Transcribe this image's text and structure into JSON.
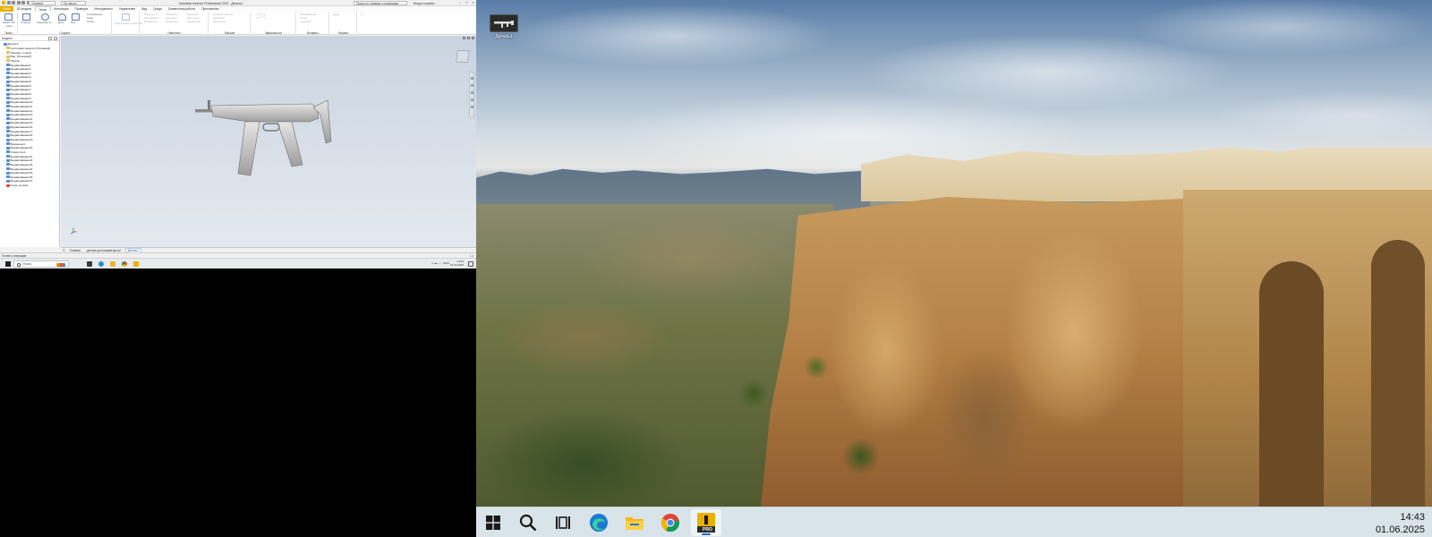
{
  "remote": {
    "titlebar": {
      "workspace_label": "Типовой",
      "mode_label": "По умолч",
      "app_title": "Autodesk Inventor Professional 2022 - Деталь1",
      "help_search_placeholder": "Поиск по справке и командам",
      "signin_label": "Вход в службы"
    },
    "ribbon_tabs": [
      "3D-модель",
      "Эскиз",
      "Аннотация",
      "Проверка",
      "Инструменты",
      "Управление",
      "Вид",
      "Среда",
      "Совместная работа",
      "Приложения"
    ],
    "ribbon_tab_active_index": 1,
    "file_tab": "Файл",
    "ribbon_groups": [
      {
        "name": "Эскиз",
        "items": [
          "Начать 2D-эскиз"
        ]
      },
      {
        "name": "Создать",
        "items": [
          "Отрезок",
          "Окружность",
          "Дуга",
          "Прямоугольник",
          "Сопряжение",
          "Текст",
          "Точка"
        ]
      },
      {
        "name": "Изменить",
        "items": [
          "Перенести",
          "Копировать",
          "Повернуть",
          "Обрезать",
          "Удлинить",
          "Разделить",
          "Масштаб",
          "Растянуть",
          "Смещение"
        ]
      },
      {
        "name": "Массив",
        "items": [
          "Прямоугольный",
          "Круговой",
          "Зеркально"
        ]
      },
      {
        "name": "Зависимости",
        "items": []
      },
      {
        "name": "Вставить",
        "items": [
          "Изображение",
          "Точки",
          "AutoCAD"
        ]
      },
      {
        "name": "Формат",
        "items": []
      }
    ],
    "browser": {
      "title": "Модель",
      "items": [
        {
          "label": "Деталь1",
          "kind": "part"
        },
        {
          "label": "Состояния модели: [Основной]",
          "kind": "folder"
        },
        {
          "label": "Твердые тела(1)",
          "kind": "folder"
        },
        {
          "label": "Вид: [Основной]",
          "kind": "folder"
        },
        {
          "label": "Начало",
          "kind": "folder"
        },
        {
          "label": "Выдавливание1",
          "kind": "ex"
        },
        {
          "label": "Выдавливание2",
          "kind": "ex"
        },
        {
          "label": "Выдавливание3",
          "kind": "ex"
        },
        {
          "label": "Выдавливание4",
          "kind": "ex"
        },
        {
          "label": "Выдавливание5",
          "kind": "ex"
        },
        {
          "label": "Выдавливание6",
          "kind": "ex"
        },
        {
          "label": "Выдавливание7",
          "kind": "ex"
        },
        {
          "label": "Выдавливание8",
          "kind": "ex"
        },
        {
          "label": "Выдавливание9",
          "kind": "ex"
        },
        {
          "label": "Выдавливание10",
          "kind": "ex"
        },
        {
          "label": "Выдавливание11",
          "kind": "ex"
        },
        {
          "label": "Выдавливание12",
          "kind": "ex"
        },
        {
          "label": "Выдавливание13",
          "kind": "ex"
        },
        {
          "label": "Выдавливание14",
          "kind": "ex"
        },
        {
          "label": "Выдавливание15",
          "kind": "ex"
        },
        {
          "label": "Выдавливание16",
          "kind": "ex"
        },
        {
          "label": "Выдавливание17",
          "kind": "ex"
        },
        {
          "label": "Выдавливание18",
          "kind": "ex"
        },
        {
          "label": "Выдавливание19",
          "kind": "ex"
        },
        {
          "label": "Вращение1",
          "kind": "ex"
        },
        {
          "label": "Выдавливание20",
          "kind": "ex"
        },
        {
          "label": "Отверстие1",
          "kind": "ex"
        },
        {
          "label": "Выдавливание21",
          "kind": "ex"
        },
        {
          "label": "Выдавливание22",
          "kind": "ex"
        },
        {
          "label": "Выдавливание23",
          "kind": "ex"
        },
        {
          "label": "Выдавливание24",
          "kind": "ex"
        },
        {
          "label": "Выдавливание25",
          "kind": "ex"
        },
        {
          "label": "Выдавливание26",
          "kind": "ex"
        },
        {
          "label": "Выдавливание27",
          "kind": "ex"
        },
        {
          "label": "Конец детали",
          "kind": "end"
        }
      ]
    },
    "doc_tabs": [
      {
        "label": "Главная",
        "active": false
      },
      {
        "label": "детали для параметра.ipt",
        "active": false
      },
      {
        "label": "Деталь1",
        "active": true
      }
    ],
    "status_text": "Готово к операции",
    "status_right": "1    1",
    "taskbar": {
      "search_placeholder": "Поиск",
      "tray_time": "14:43",
      "tray_date": "01.06.2025",
      "lang": "ENG"
    }
  },
  "desktop": {
    "icon_label": "Деталь1"
  },
  "taskbar": {
    "pinned": [
      {
        "name": "start",
        "icon": "windows-logo"
      },
      {
        "name": "search",
        "icon": "search-icon"
      },
      {
        "name": "task-view",
        "icon": "task-view-icon"
      },
      {
        "name": "edge",
        "icon": "edge-icon"
      },
      {
        "name": "explorer",
        "icon": "folder-icon"
      },
      {
        "name": "chrome",
        "icon": "chrome-icon"
      },
      {
        "name": "inventor",
        "icon": "inventor-icon",
        "active": true
      }
    ],
    "time": "14:43",
    "date": "01.06.2025",
    "inventor_badge": "PRO"
  },
  "colors": {
    "inventor_accent": "#e8b100",
    "taskbar_bg": "#d9e4ea",
    "viewport_bg": "#cad4e0"
  }
}
